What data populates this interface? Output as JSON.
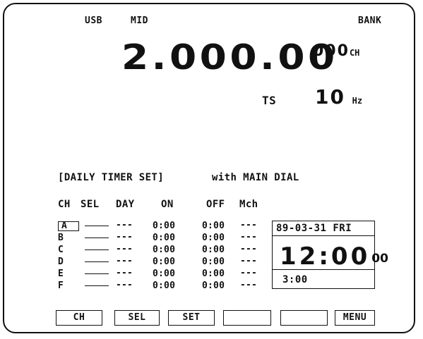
{
  "top": {
    "mode": "USB",
    "filter": "MID",
    "bank": "BANK"
  },
  "frequency": {
    "value": "2.000.00",
    "channel": "000",
    "channel_unit": "CH"
  },
  "tuning_step": {
    "label": "TS",
    "value": "10",
    "unit": "Hz"
  },
  "timer": {
    "title": "[DAILY TIMER SET]",
    "mode_text": "with MAIN DIAL",
    "columns": [
      "CH",
      "SEL",
      "DAY",
      "ON",
      "OFF",
      "Mch"
    ],
    "rows": [
      {
        "ch": "A",
        "day": "---",
        "on": "0:00",
        "off": "0:00",
        "mch": "---"
      },
      {
        "ch": "B",
        "day": "---",
        "on": "0:00",
        "off": "0:00",
        "mch": "---"
      },
      {
        "ch": "C",
        "day": "---",
        "on": "0:00",
        "off": "0:00",
        "mch": "---"
      },
      {
        "ch": "D",
        "day": "---",
        "on": "0:00",
        "off": "0:00",
        "mch": "---"
      },
      {
        "ch": "E",
        "day": "---",
        "on": "0:00",
        "off": "0:00",
        "mch": "---"
      },
      {
        "ch": "F",
        "day": "---",
        "on": "0:00",
        "off": "0:00",
        "mch": "---"
      }
    ]
  },
  "clock": {
    "date": "89-03-31 FRI",
    "hours_minutes": "12:00",
    "seconds": "00",
    "small_time": "3:00"
  },
  "softkeys": [
    "CH",
    "SEL",
    "SET",
    "",
    "",
    "MENU"
  ]
}
